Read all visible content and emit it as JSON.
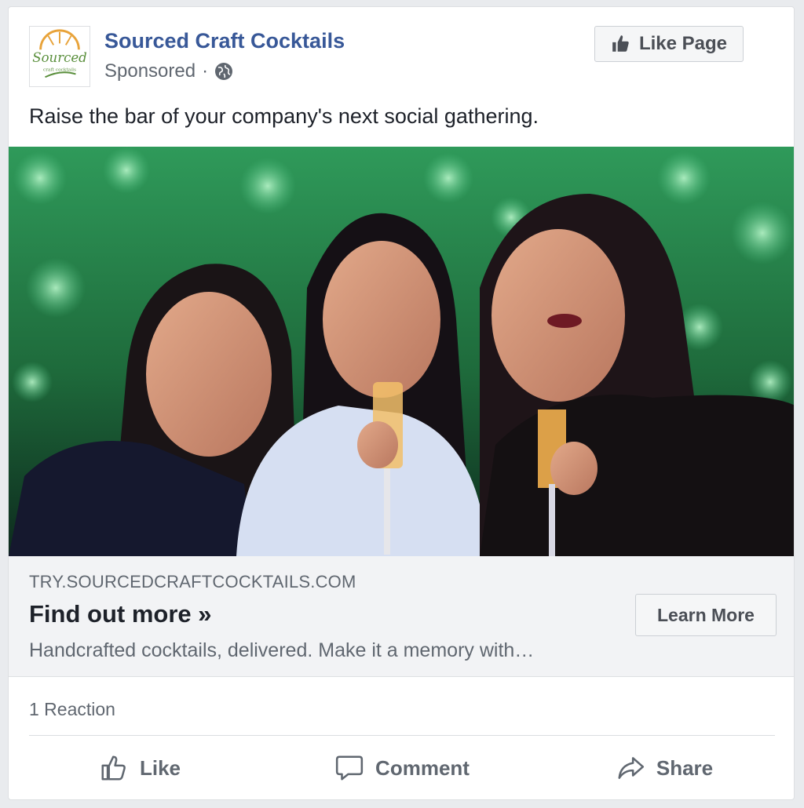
{
  "post": {
    "page_name": "Sourced Craft Cocktails",
    "sponsored_label": "Sponsored",
    "separator": "·",
    "privacy_icon": "globe-icon",
    "like_page_label": "Like Page",
    "message": "Raise the bar of your company's next social gathering."
  },
  "logo": {
    "wordmark": "Sourced",
    "tagline": "craft cocktails"
  },
  "link": {
    "domain": "TRY.SOURCEDCRAFTCOCKTAILS.COM",
    "headline": "Find out more »",
    "description": "Handcrafted cocktails, delivered. Make it a memory with…",
    "cta_label": "Learn More"
  },
  "engagement": {
    "reactions_text": "1 Reaction"
  },
  "actions": [
    {
      "label": "Like",
      "icon": "thumbs-up-icon"
    },
    {
      "label": "Comment",
      "icon": "comment-icon"
    },
    {
      "label": "Share",
      "icon": "share-icon"
    }
  ],
  "colors": {
    "brand_link": "#385898",
    "text_primary": "#1d2129",
    "text_secondary": "#606770",
    "link_box_bg": "#f2f3f5"
  }
}
